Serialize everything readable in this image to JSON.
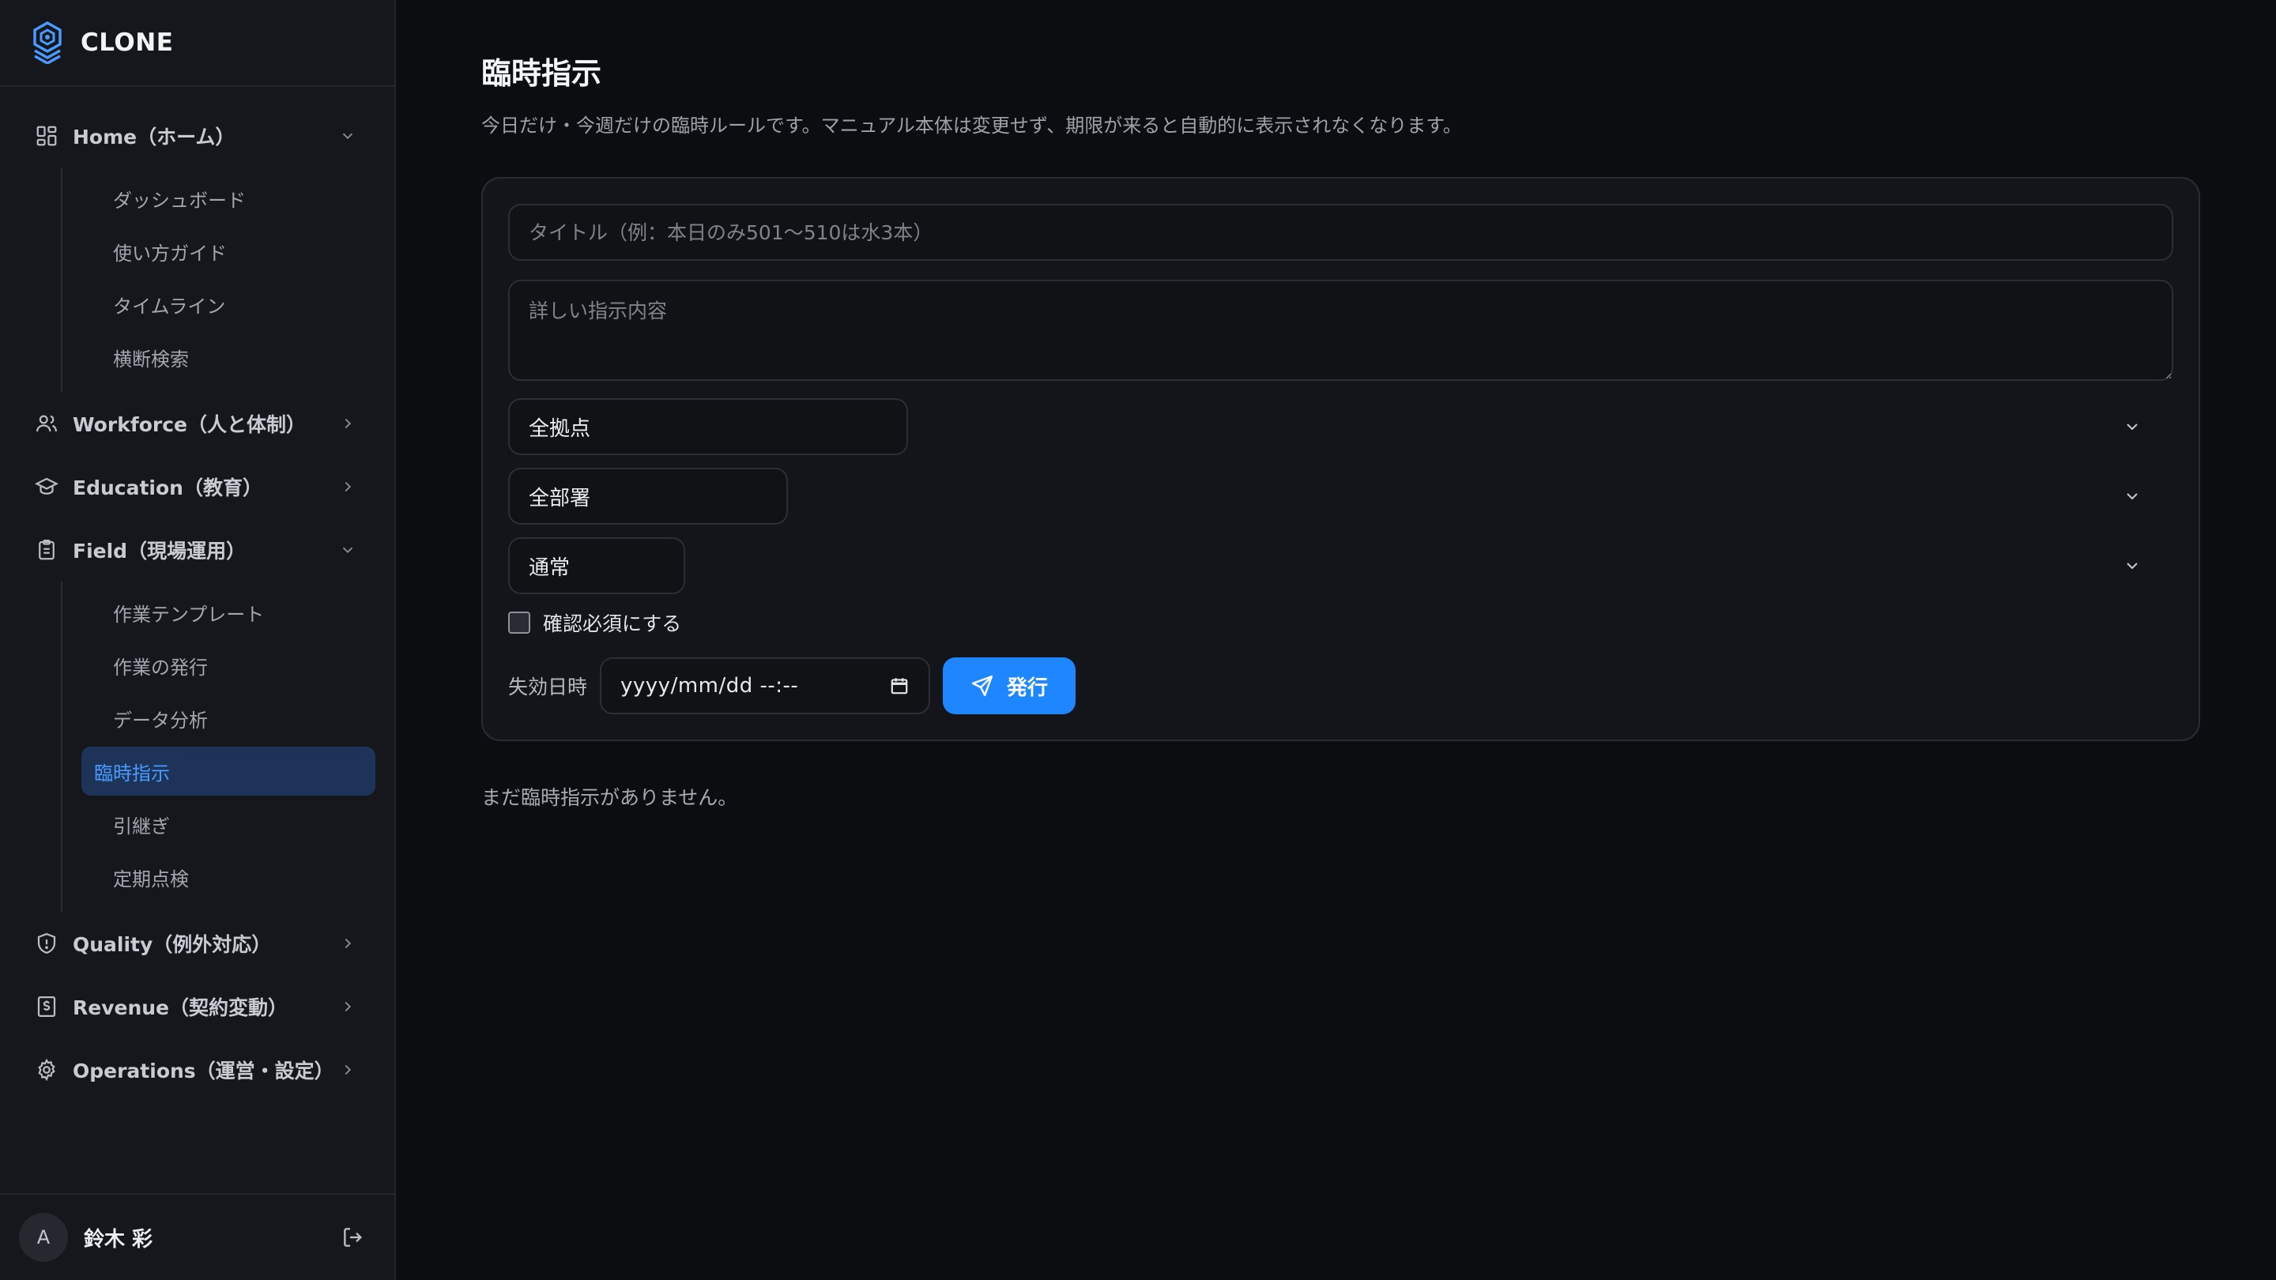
{
  "brand": {
    "name": "CLONE"
  },
  "sidebar": {
    "groups": [
      {
        "label": "Home（ホーム）",
        "icon": "grid-icon",
        "expanded": true,
        "items": [
          {
            "label": "ダッシュボード"
          },
          {
            "label": "使い方ガイド"
          },
          {
            "label": "タイムライン"
          },
          {
            "label": "横断検索"
          }
        ]
      },
      {
        "label": "Workforce（人と体制）",
        "icon": "users-icon",
        "expanded": false,
        "items": []
      },
      {
        "label": "Education（教育）",
        "icon": "graduation-cap-icon",
        "expanded": false,
        "items": []
      },
      {
        "label": "Field（現場運用）",
        "icon": "clipboard-icon",
        "expanded": true,
        "items": [
          {
            "label": "作業テンプレート"
          },
          {
            "label": "作業の発行"
          },
          {
            "label": "データ分析"
          },
          {
            "label": "臨時指示",
            "active": true
          },
          {
            "label": "引継ぎ"
          },
          {
            "label": "定期点検"
          }
        ]
      },
      {
        "label": "Quality（例外対応）",
        "icon": "shield-alert-icon",
        "expanded": false,
        "items": []
      },
      {
        "label": "Revenue（契約変動）",
        "icon": "receipt-icon",
        "expanded": false,
        "items": []
      },
      {
        "label": "Operations（運営・設定）",
        "icon": "gear-icon",
        "expanded": false,
        "items": []
      }
    ]
  },
  "user": {
    "initial": "A",
    "name": "鈴木 彩"
  },
  "page": {
    "title": "臨時指示",
    "description": "今日だけ・今週だけの臨時ルールです。マニュアル本体は変更せず、期限が来ると自動的に表示されなくなります。"
  },
  "form": {
    "title_placeholder": "タイトル（例：本日のみ501〜510は水3本）",
    "body_placeholder": "詳しい指示内容",
    "site_select": "全拠点",
    "department_select": "全部署",
    "priority_select": "通常",
    "confirm_label": "確認必須にする",
    "confirm_checked": false,
    "expiry_label": "失効日時",
    "expiry_value": "yyyy/mm/dd --:--",
    "submit_label": "発行"
  },
  "empty_message": "まだ臨時指示がありません。",
  "colors": {
    "accent": "#1e86ff",
    "active_bg": "#1e3358",
    "active_text": "#4a9bff"
  }
}
